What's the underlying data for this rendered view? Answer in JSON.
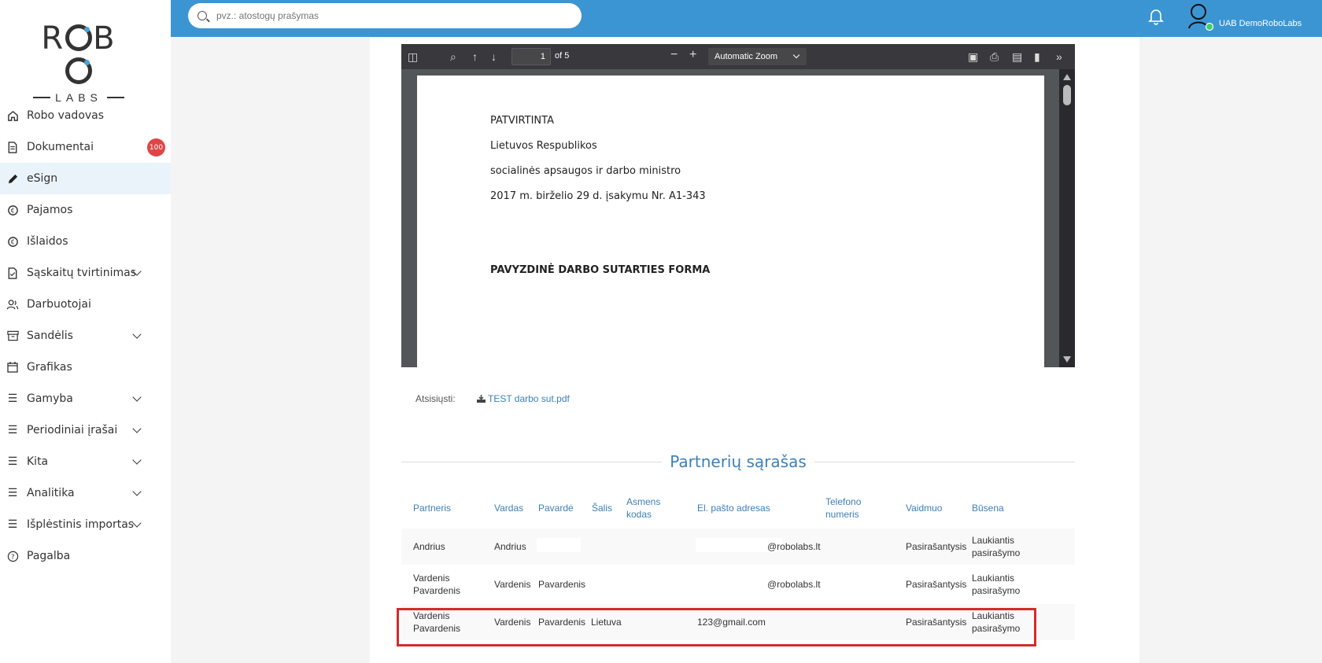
{
  "sidebar": {
    "logo_top": "ROBO",
    "logo_bottom": "LABS",
    "items": [
      {
        "label": "Robo vadovas",
        "icon": "home-icon"
      },
      {
        "label": "Dokumentai",
        "icon": "document-icon",
        "badge": "100"
      },
      {
        "label": "eSign",
        "icon": "pen-icon",
        "active": true
      },
      {
        "label": "Pajamos",
        "icon": "income-icon"
      },
      {
        "label": "Išlaidos",
        "icon": "expenses-icon"
      },
      {
        "label": "Sąskaitų tvirtinimas",
        "icon": "invoice-check-icon",
        "expandable": true
      },
      {
        "label": "Darbuotojai",
        "icon": "people-icon"
      },
      {
        "label": "Sandėlis",
        "icon": "archive-icon",
        "expandable": true
      },
      {
        "label": "Grafikas",
        "icon": "calendar-icon"
      },
      {
        "label": "Gamyba",
        "icon": "list-icon",
        "expandable": true
      },
      {
        "label": "Periodiniai įrašai",
        "icon": "list-icon",
        "expandable": true
      },
      {
        "label": "Kita",
        "icon": "list-icon",
        "expandable": true
      },
      {
        "label": "Analitika",
        "icon": "list-icon",
        "expandable": true
      },
      {
        "label": "Išplėstinis importas",
        "icon": "list-icon",
        "expandable": true
      },
      {
        "label": "Pagalba",
        "icon": "help-icon"
      }
    ]
  },
  "topbar": {
    "search_placeholder": "pvz.: atostogų prašymas",
    "company": "UAB DemoRoboLabs"
  },
  "pdf": {
    "page_number": "1",
    "page_of": "of 5",
    "zoom": "Automatic Zoom",
    "lines": [
      "PATVIRTINTA",
      "Lietuvos Respublikos",
      "socialinės apsaugos ir darbo ministro",
      "2017 m. birželio 29 d. įsakymu Nr. A1-343"
    ],
    "heading": "PAVYZDINĖ DARBO SUTARTIES FORMA"
  },
  "download": {
    "label": "Atsisiųsti:",
    "file": "TEST darbo sut.pdf"
  },
  "partners": {
    "title": "Partnerių sąrašas",
    "headers": {
      "partneris": "Partneris",
      "vardas": "Vardas",
      "pavarde": "Pavardė",
      "salis": "Šalis",
      "asmens_kodas_1": "Asmens",
      "asmens_kodas_2": "kodas",
      "el_pastas": "El. pašto adresas",
      "telefonas_1": "Telefono",
      "telefonas_2": "numeris",
      "vaidmuo": "Vaidmuo",
      "busena": "Būsena"
    },
    "rows": [
      {
        "partneris_1": "Andrius",
        "partneris_2": "",
        "vardas": "Andrius",
        "pavarde": "",
        "salis": "",
        "email": "@robolabs.lt",
        "vaidmuo": "Pasirašantysis",
        "busena_1": "Laukiantis",
        "busena_2": "pasirašymo"
      },
      {
        "partneris_1": "Vardenis",
        "partneris_2": "Pavardenis",
        "vardas": "Vardenis",
        "pavarde": "Pavardenis",
        "salis": "",
        "email": "@robolabs.lt",
        "vaidmuo": "Pasirašantysis",
        "busena_1": "Laukiantis",
        "busena_2": "pasirašymo"
      },
      {
        "partneris_1": "Vardenis",
        "partneris_2": "Pavardenis",
        "vardas": "Vardenis",
        "pavarde": "Pavardenis",
        "salis": "Lietuva",
        "email": "123@gmail.com",
        "vaidmuo": "Pasirašantysis",
        "busena_1": "Laukiantis",
        "busena_2": "pasirašymo"
      }
    ]
  },
  "colors": {
    "topbar": "#3c95d3",
    "accent": "#3c7fb8",
    "highlight": "#d12c2c",
    "badge": "#e04545"
  }
}
